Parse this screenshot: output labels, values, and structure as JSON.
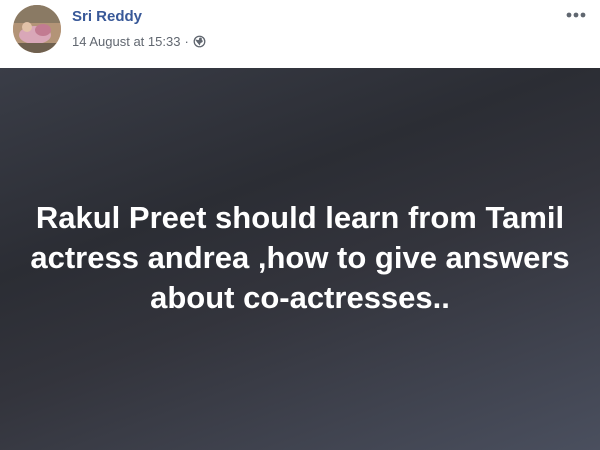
{
  "post": {
    "author": "Sri Reddy",
    "timestamp": "14 August at 15:33",
    "separator": "·",
    "privacy_icon": "globe-icon",
    "menu_icon": "more-horizontal-icon",
    "avatar_icon": "profile-avatar",
    "text": "Rakul Preet should learn from Tamil actress andrea ,how to give answers about co-actresses..",
    "colors": {
      "author_link": "#385898",
      "meta_text": "#616770",
      "body_background": "#2f3138",
      "body_text": "#ffffff"
    }
  }
}
